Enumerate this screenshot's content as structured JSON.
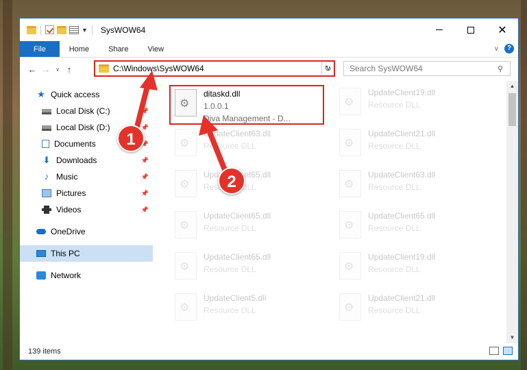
{
  "window": {
    "title": "SysWOW64"
  },
  "ribbon": {
    "tabs": [
      "File",
      "Home",
      "Share",
      "View"
    ]
  },
  "nav": {
    "address": "C:\\Windows\\SysWOW64",
    "search_placeholder": "Search SysWOW64"
  },
  "sidebar": {
    "items": [
      {
        "label": "Quick access",
        "icon": "star-icon"
      },
      {
        "label": "Local Disk (C:)",
        "icon": "disk-icon",
        "pinned": true
      },
      {
        "label": "Local Disk (D:)",
        "icon": "disk-icon",
        "pinned": true
      },
      {
        "label": "Documents",
        "icon": "documents-icon",
        "pinned": true
      },
      {
        "label": "Downloads",
        "icon": "download-icon",
        "pinned": true
      },
      {
        "label": "Music",
        "icon": "music-icon",
        "pinned": true
      },
      {
        "label": "Pictures",
        "icon": "pictures-icon",
        "pinned": true
      },
      {
        "label": "Videos",
        "icon": "videos-icon",
        "pinned": true
      },
      {
        "label": "OneDrive",
        "icon": "onedrive-icon"
      },
      {
        "label": "This PC",
        "icon": "computer-icon",
        "selected": true
      },
      {
        "label": "Network",
        "icon": "network-icon"
      }
    ]
  },
  "files": [
    {
      "name": "ditaskd.dll",
      "version": "1.0.0.1",
      "desc": "Diva Management - D...",
      "highlighted": true
    },
    {
      "name": "UpdateClient19.dll",
      "desc": "Resource DLL"
    },
    {
      "name": "UpdateClient63.dll",
      "desc": "Resource DLL"
    },
    {
      "name": "UpdateClient21.dll",
      "desc": "Resource DLL"
    },
    {
      "name": "UpdateClient65.dll",
      "desc": "Resource DLL"
    },
    {
      "name": "UpdateClient63.dll",
      "desc": "Resource DLL"
    },
    {
      "name": "UpdateClient65.dll",
      "desc": "Resource DLL"
    },
    {
      "name": "UpdateClient65.dll",
      "desc": "Resource DLL"
    },
    {
      "name": "UpdateClient65.dll",
      "desc": "Resource DLL"
    },
    {
      "name": "UpdateClient19.dll",
      "desc": "Resource DLL"
    },
    {
      "name": "UpdateClient5.dll",
      "desc": "Resource DLL"
    },
    {
      "name": "UpdateClient21.dll",
      "desc": "Resource DLL"
    }
  ],
  "status": {
    "item_count": "139 items"
  },
  "callouts": [
    "1",
    "2"
  ],
  "colors": {
    "accent": "#1a6fc4",
    "highlight": "#d9251d",
    "badge": "#e4322b"
  }
}
